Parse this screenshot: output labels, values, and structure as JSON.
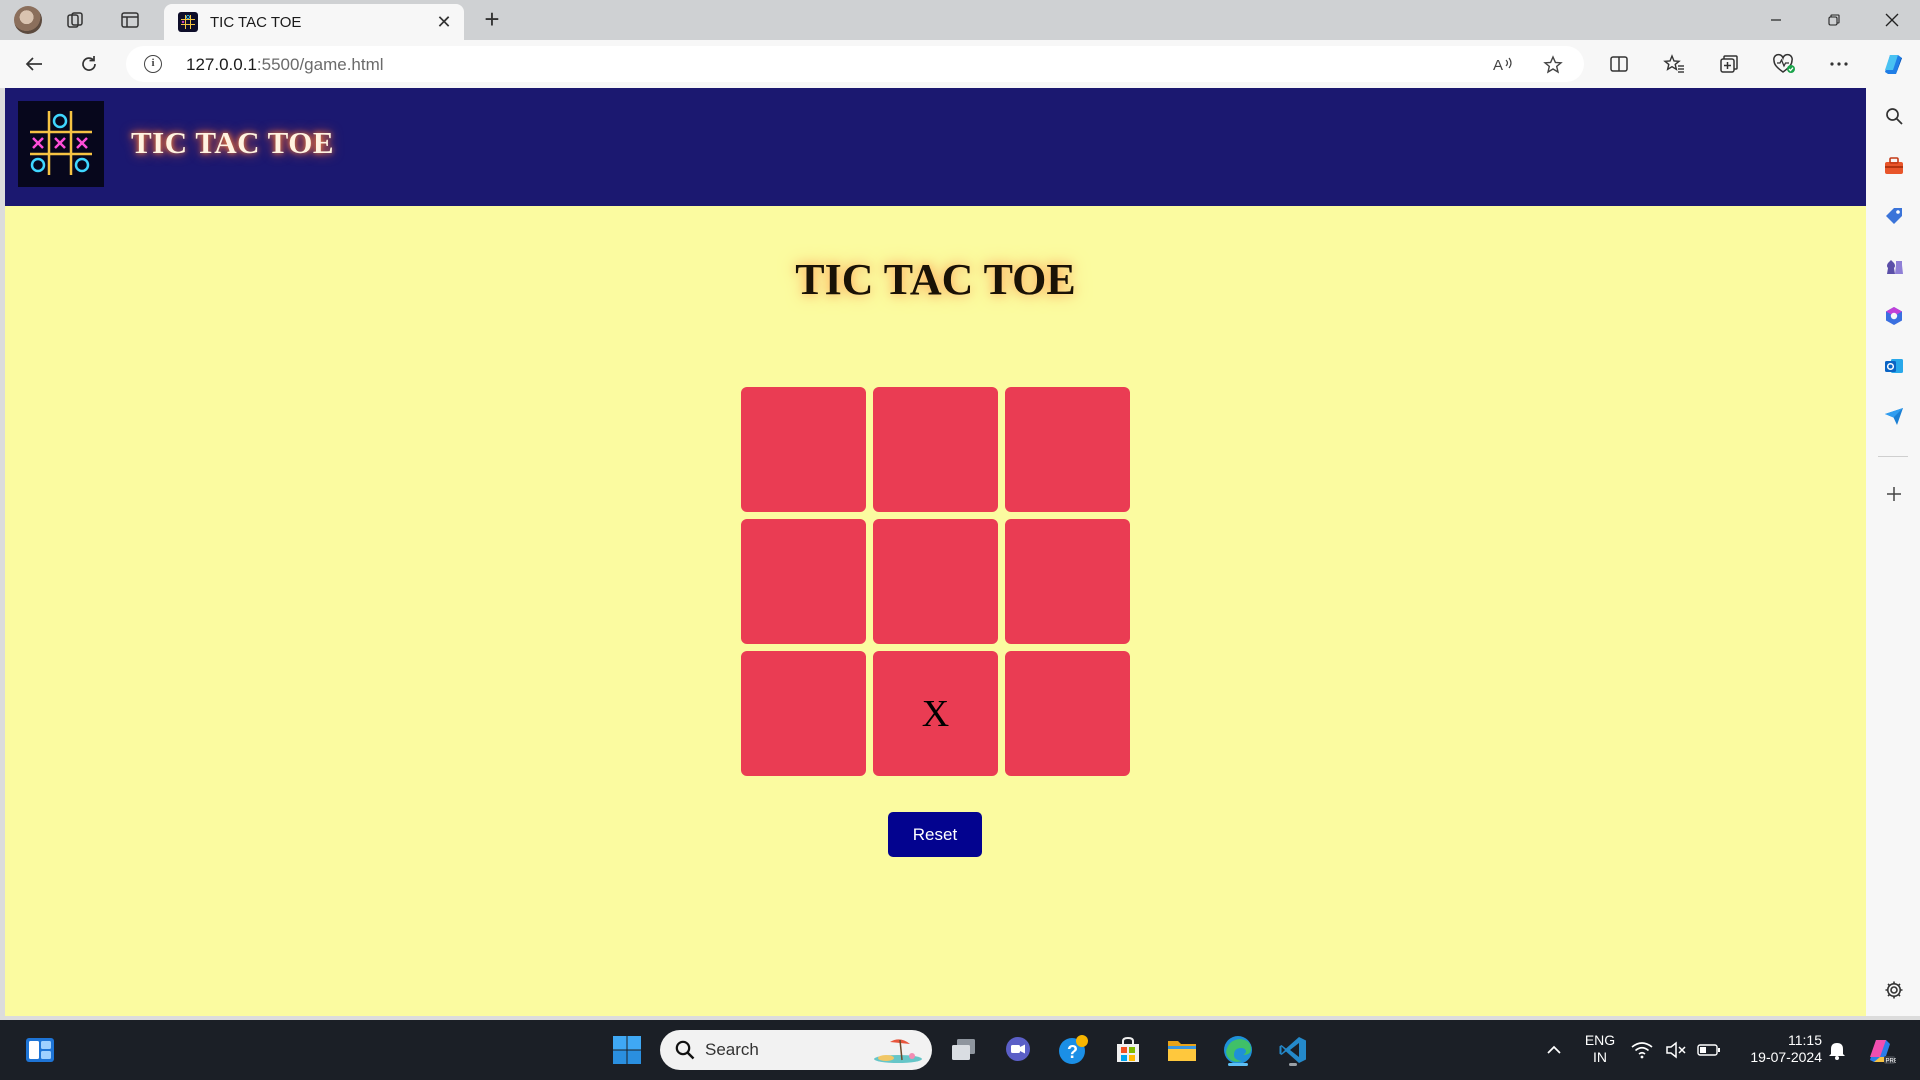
{
  "browser": {
    "tab_title": "TIC TAC TOE",
    "url_host": "127.0.0.1",
    "url_rest": ":5500/game.html"
  },
  "page": {
    "header_title": "TIC TAC TOE",
    "game_title": "TIC TAC TOE",
    "board": [
      "",
      "",
      "",
      "",
      "",
      "",
      "",
      "X",
      ""
    ],
    "reset_label": "Reset"
  },
  "taskbar": {
    "search_placeholder": "Search",
    "language_line1": "ENG",
    "language_line2": "IN",
    "time": "11:15",
    "date": "19-07-2024"
  },
  "colors": {
    "page_background": "#fbfba0",
    "header_background": "#1b1870",
    "cell": "#ea3c53",
    "reset_button": "#03038f"
  }
}
